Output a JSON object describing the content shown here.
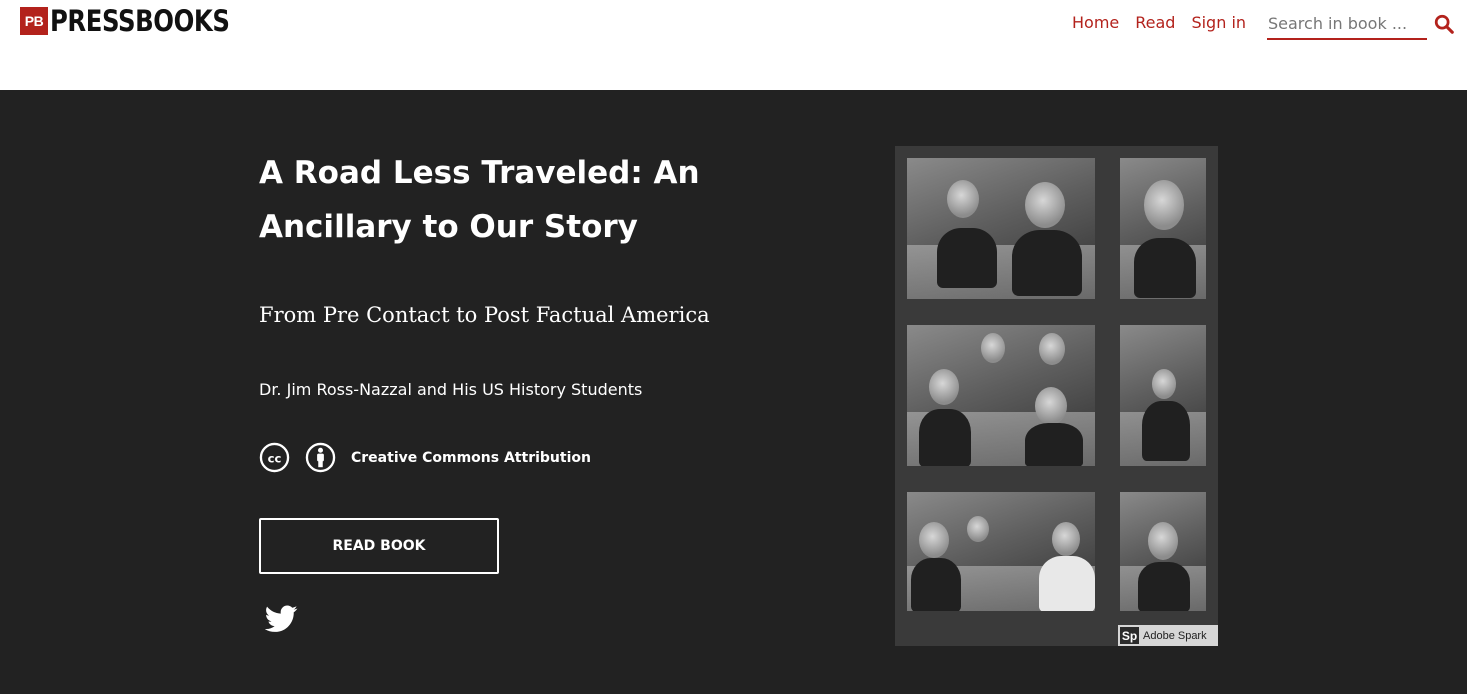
{
  "header": {
    "logo_badge": "PB",
    "logo_text": "PRESSBOOKS",
    "nav": {
      "home": "Home",
      "read": "Read",
      "sign_in": "Sign in"
    },
    "search": {
      "placeholder": "Search in book ..."
    },
    "accent_color": "#b3221c"
  },
  "hero": {
    "title": "A Road Less Traveled: An Ancillary to Our Story",
    "subtitle": "From Pre Contact to Post Factual America",
    "author": "Dr. Jim Ross-Nazzal and His US History Students",
    "license": {
      "label": "Creative Commons Attribution",
      "icons": [
        "cc-icon",
        "attribution-icon"
      ]
    },
    "read_button": "READ BOOK",
    "social": [
      "twitter-icon"
    ],
    "background_color": "#222222"
  },
  "cover": {
    "badge": "Sp",
    "badge_text": "Adobe Spark"
  }
}
